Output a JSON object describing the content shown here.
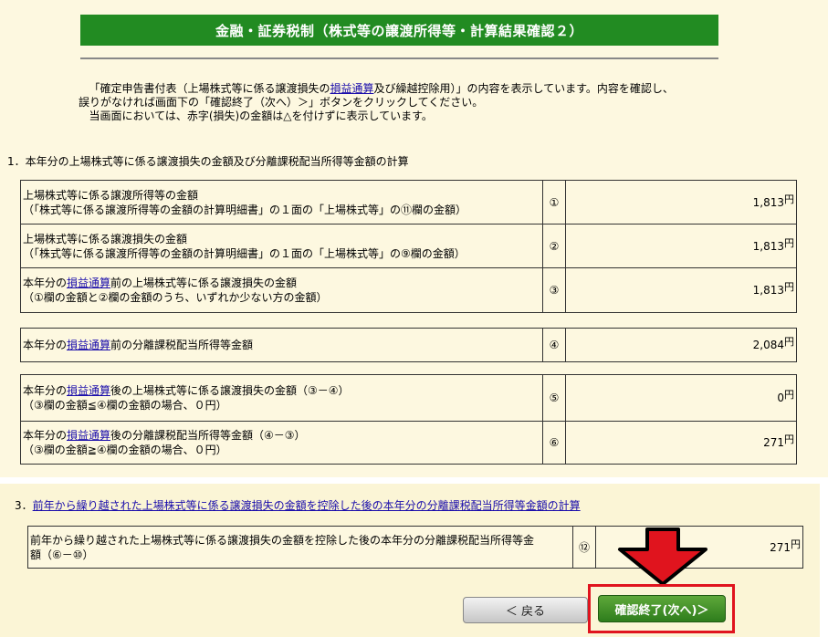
{
  "header": {
    "title": "金融・証券税制（株式等の譲渡所得等・計算結果確認２）"
  },
  "intro": {
    "line1_a": "「確定申告書付表（上場株式等に係る譲渡損失の",
    "line1_link": "損益通算",
    "line1_b": "及び繰越控除用）」の内容を表示しています。内容を確認し、",
    "line2": "誤りがなければ画面下の「確認終了（次へ）＞」ボタンをクリックしてください。",
    "line3": "当画面においては、赤字(損失)の金額は△を付けずに表示しています。"
  },
  "section1": {
    "title": "1．本年分の上場株式等に係る譲渡損失の金額及び分離課税配当所得等金額の計算",
    "rows": [
      {
        "label1": "上場株式等に係る譲渡所得等の金額",
        "label2": "（「株式等に係る譲渡所得等の金額の計算明細書」の１面の「上場株式等」の⑪欄の金額）",
        "num": "①",
        "value": "1,813",
        "unit": "円"
      },
      {
        "label1": "上場株式等に係る譲渡損失の金額",
        "label2": "（「株式等に係る譲渡所得等の金額の計算明細書」の１面の「上場株式等」の⑨欄の金額）",
        "num": "②",
        "value": "1,813",
        "unit": "円"
      },
      {
        "label1_a": "本年分の",
        "label1_link": "損益通算",
        "label1_b": "前の上場株式等に係る譲渡損失の金額",
        "label2": "（①欄の金額と②欄の金額のうち、いずれか少ない方の金額）",
        "num": "③",
        "value": "1,813",
        "unit": "円"
      },
      {
        "label1_a": "本年分の",
        "label1_link": "損益通算",
        "label1_b": "前の分離課税配当所得等金額",
        "num": "④",
        "value": "2,084",
        "unit": "円"
      },
      {
        "label1_a": "本年分の",
        "label1_link": "損益通算",
        "label1_b": "後の上場株式等に係る譲渡損失の金額（③－④）",
        "label2": "（③欄の金額≦④欄の金額の場合、０円）",
        "num": "⑤",
        "value": "0",
        "unit": "円"
      },
      {
        "label1_a": "本年分の",
        "label1_link": "損益通算",
        "label1_b": "後の分離課税配当所得等金額（④－③）",
        "label2": "（③欄の金額≧④欄の金額の場合、０円）",
        "num": "⑥",
        "value": "271",
        "unit": "円"
      }
    ]
  },
  "section3": {
    "prefix": "3．",
    "title_link": "前年から繰り越された上場株式等に係る譲渡損失の金額を控除した後の本年分の分離課税配当所得等金額の計算",
    "row": {
      "label1": "前年から繰り越された上場株式等に係る譲渡損失の金額を控除した後の本年分の分離課税配当所得等金",
      "label2": "額（⑥－⑩）",
      "num": "⑫",
      "value": "271",
      "unit": "円"
    }
  },
  "buttons": {
    "back": "＜ 戻る",
    "next": "確認終了(次へ)＞"
  },
  "colors": {
    "header": "#228b22",
    "highlight": "#e0141e",
    "background": "#fdf8e0"
  }
}
